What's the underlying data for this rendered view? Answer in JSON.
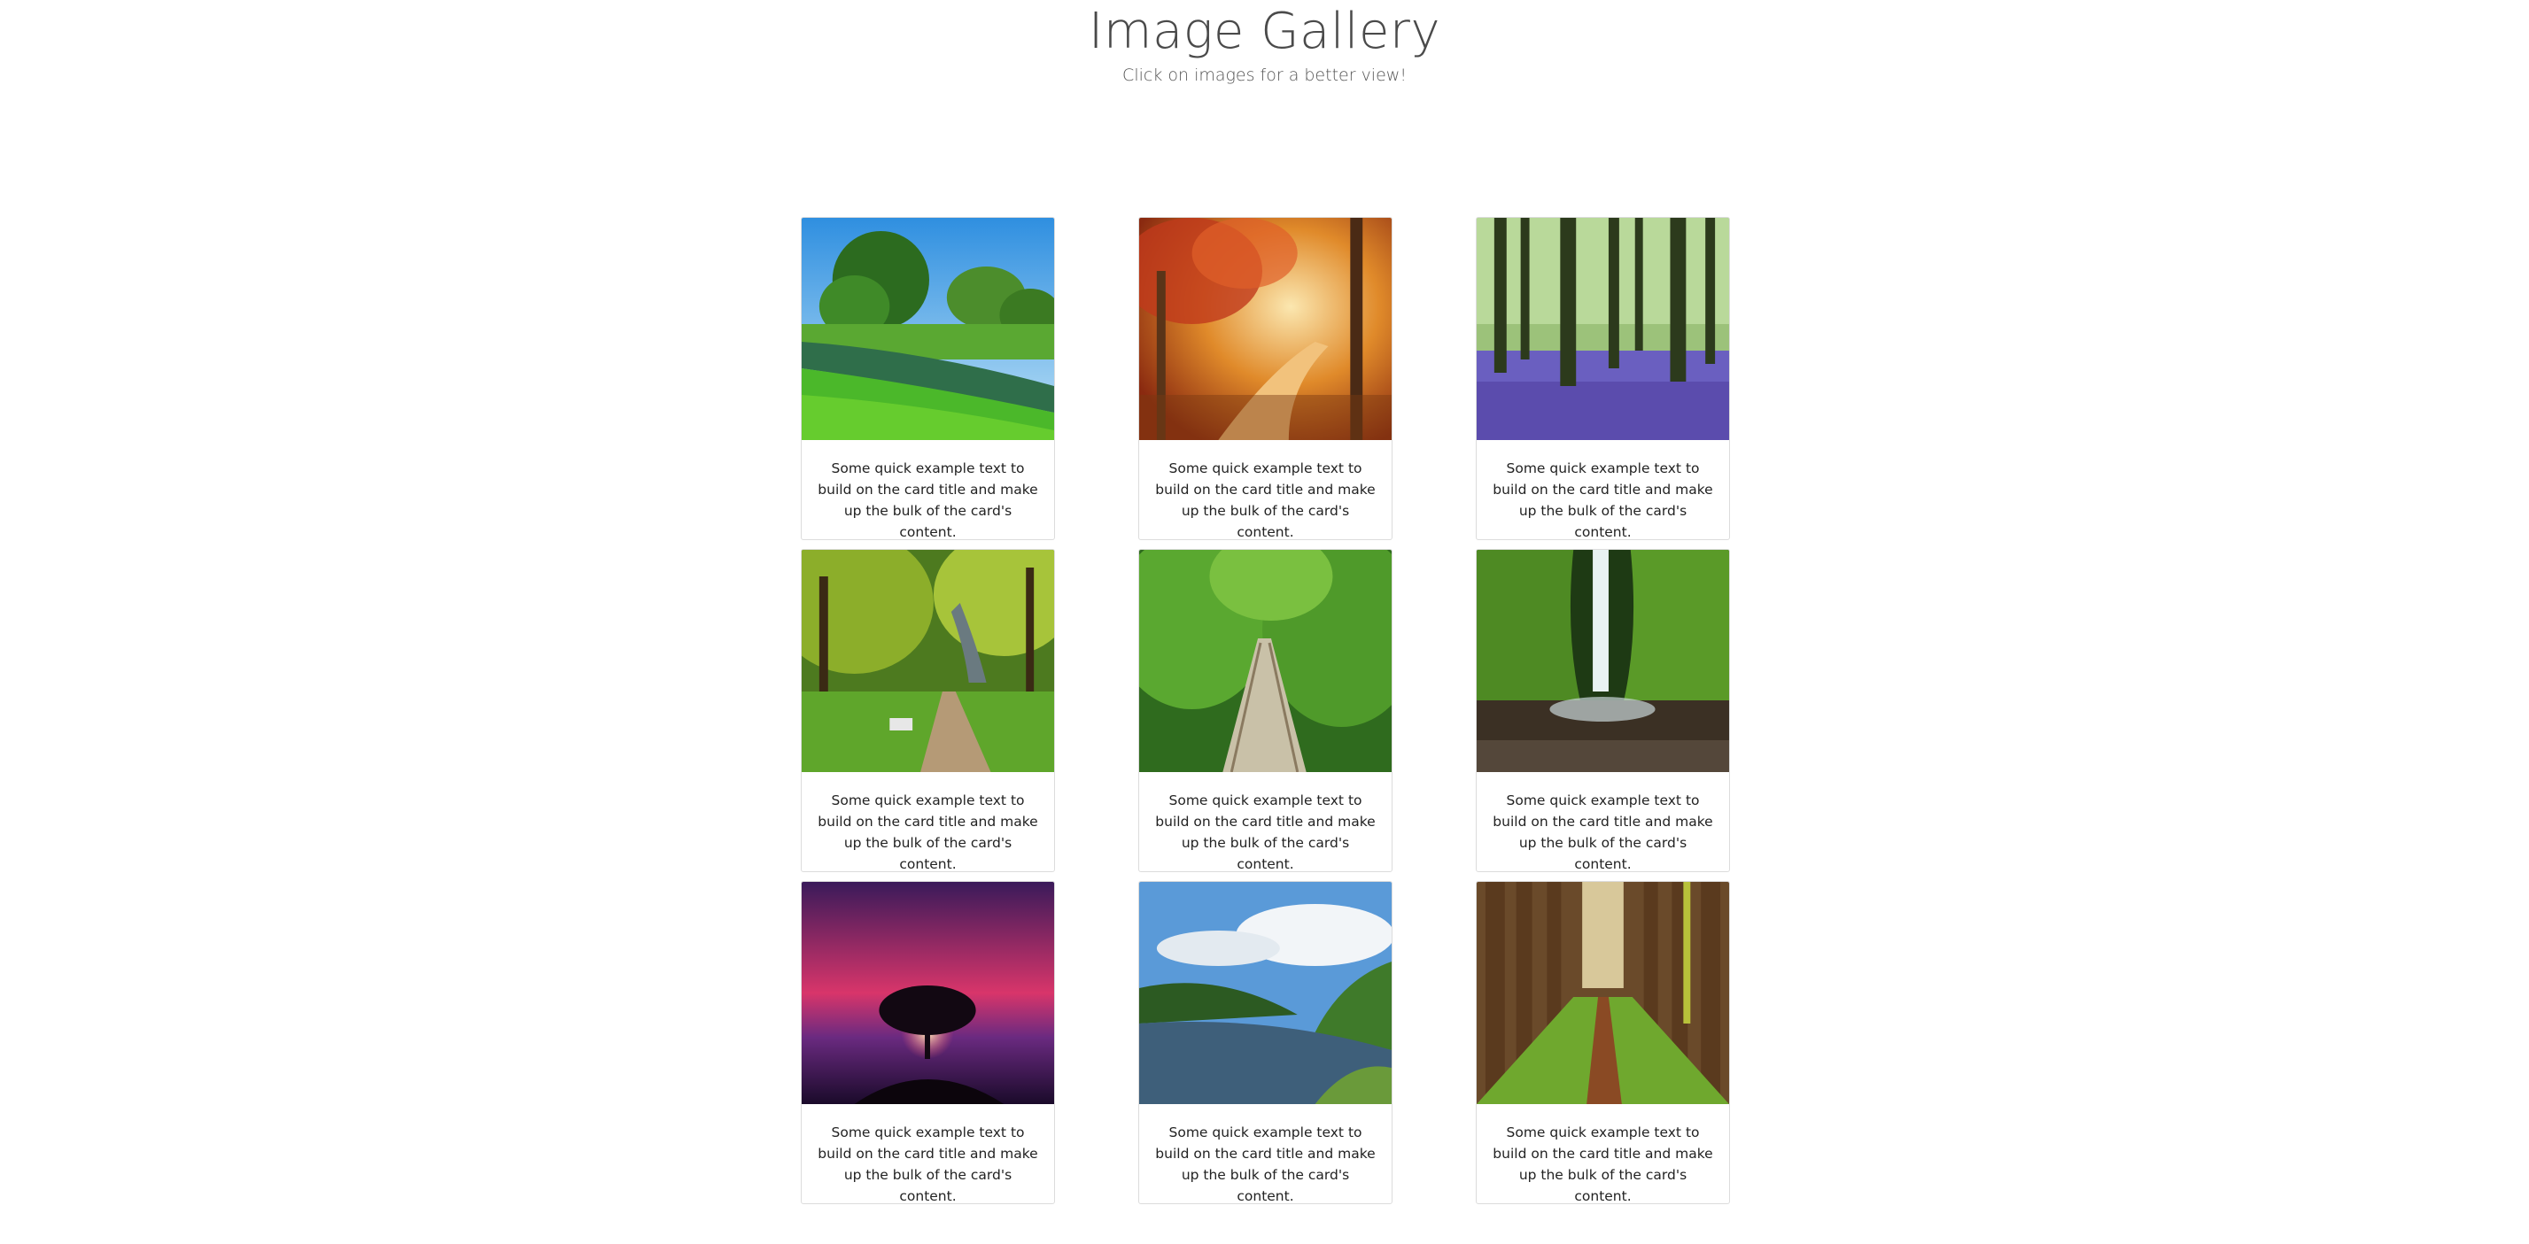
{
  "header": {
    "title": "Image Gallery",
    "subtitle": "Click on images for a better view!"
  },
  "cards": [
    {
      "image": "green-park-lake-image",
      "text": "Some quick example text to build on the card title and make up the bulk of the card's content."
    },
    {
      "image": "autumn-forest-path-image",
      "text": "Some quick example text to build on the card title and make up the bulk of the card's content."
    },
    {
      "image": "bluebell-forest-image",
      "text": "Some quick example text to build on the card title and make up the bulk of the card's content."
    },
    {
      "image": "park-path-bench-image",
      "text": "Some quick example text to build on the card title and make up the bulk of the card's content."
    },
    {
      "image": "jungle-boardwalk-image",
      "text": "Some quick example text to build on the card title and make up the bulk of the card's content."
    },
    {
      "image": "gorge-waterfall-image",
      "text": "Some quick example text to build on the card title and make up the bulk of the card's content."
    },
    {
      "image": "tree-sunset-image",
      "text": "Some quick example text to build on the card title and make up the bulk of the card's content."
    },
    {
      "image": "river-valley-image",
      "text": "Some quick example text to build on the card title and make up the bulk of the card's content."
    },
    {
      "image": "tree-lined-path-image",
      "text": "Some quick example text to build on the card title and make up the bulk of the card's content."
    }
  ]
}
